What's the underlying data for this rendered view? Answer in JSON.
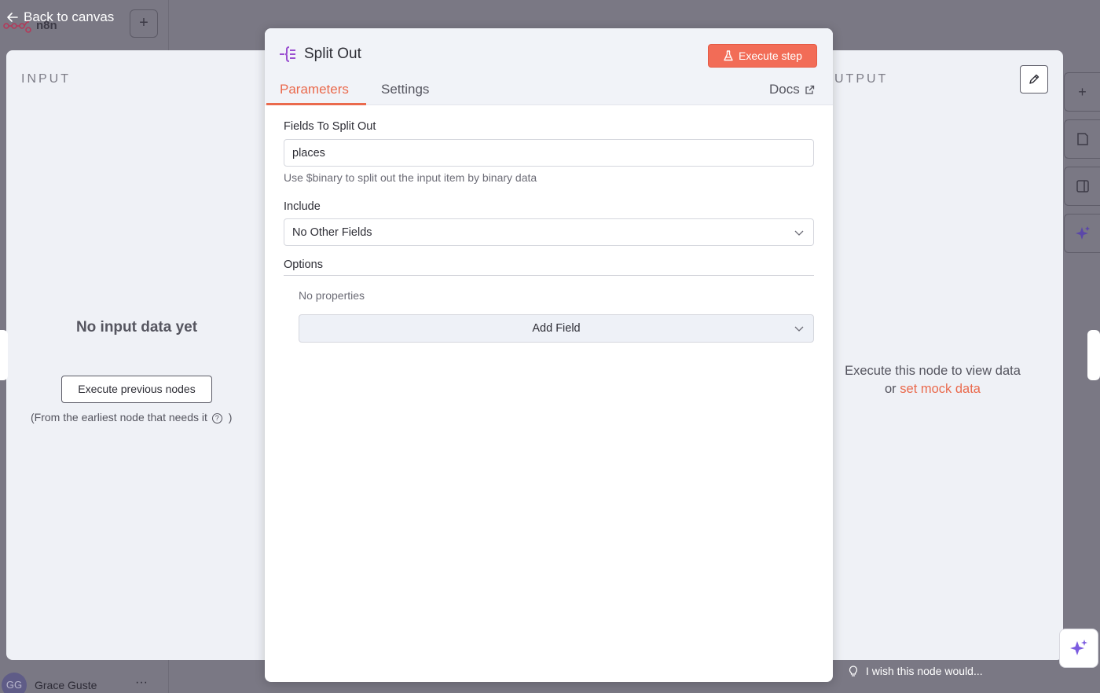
{
  "background": {
    "app_name": "n8n",
    "user_initials": "GG",
    "user_name": "Grace Guste",
    "user_more": "···",
    "plus_label": "+"
  },
  "nav": {
    "back_label": "Back to canvas"
  },
  "input_panel": {
    "heading": "INPUT",
    "empty_title": "No input data yet",
    "execute_previous_label": "Execute previous nodes",
    "note_prefix": "(From the earliest node that needs it",
    "note_suffix": ")",
    "help_icon": "?"
  },
  "output_panel": {
    "heading": "UTPUT",
    "message_line1": "Execute this node to view data",
    "message_or": "or",
    "mock_link": "set mock data"
  },
  "node": {
    "title": "Split Out",
    "execute_label": "Execute step",
    "tabs": [
      {
        "label": "Parameters",
        "active": true
      },
      {
        "label": "Settings",
        "active": false
      }
    ],
    "docs_label": "Docs",
    "accent_color": "#ea6a4d",
    "icon_color": "#9a4fd0"
  },
  "params": {
    "fields_to_split_label": "Fields To Split Out",
    "fields_to_split_value": "places",
    "fields_hint": "Use $binary to split out the input item by binary data",
    "include_label": "Include",
    "include_value": "No Other Fields",
    "options_label": "Options",
    "no_properties": "No properties",
    "add_field_label": "Add Field"
  },
  "footer": {
    "feedback_label": "I wish this node would..."
  }
}
